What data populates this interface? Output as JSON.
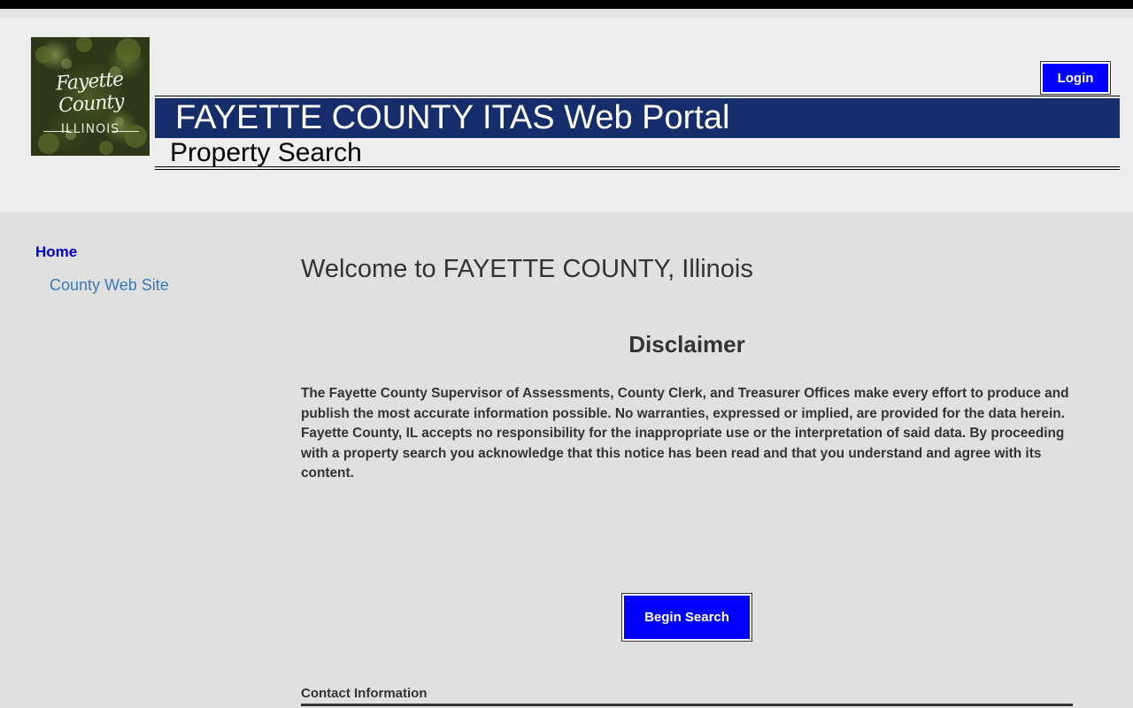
{
  "header": {
    "logo": {
      "line1": "Fayette County",
      "line2": "ILLINOIS"
    },
    "title": "FAYETTE COUNTY ITAS Web Portal",
    "subtitle": "Property Search",
    "login_label": "Login"
  },
  "sidebar": {
    "items": [
      {
        "label": "Home"
      },
      {
        "label": "County Web Site"
      }
    ]
  },
  "main": {
    "welcome": "Welcome to FAYETTE COUNTY, Illinois",
    "disclaimer_title": "Disclaimer",
    "disclaimer_text": "The Fayette County Supervisor of Assessments, County Clerk, and Treasurer Offices make every effort to produce and publish the most accurate information possible.  No warranties, expressed or implied, are provided for the data herein.  Fayette County, IL accepts no responsibility for the inappropriate use or the interpretation of said data.  By proceeding with a property search you acknowledge that this notice has been read and that you understand and agree with its content.",
    "begin_search_label": "Begin Search",
    "contact_heading": "Contact Information"
  },
  "colors": {
    "banner": "#162d6b",
    "button": "#0000ff",
    "home_link": "#0000cc",
    "county_link": "#3a7ab8"
  }
}
